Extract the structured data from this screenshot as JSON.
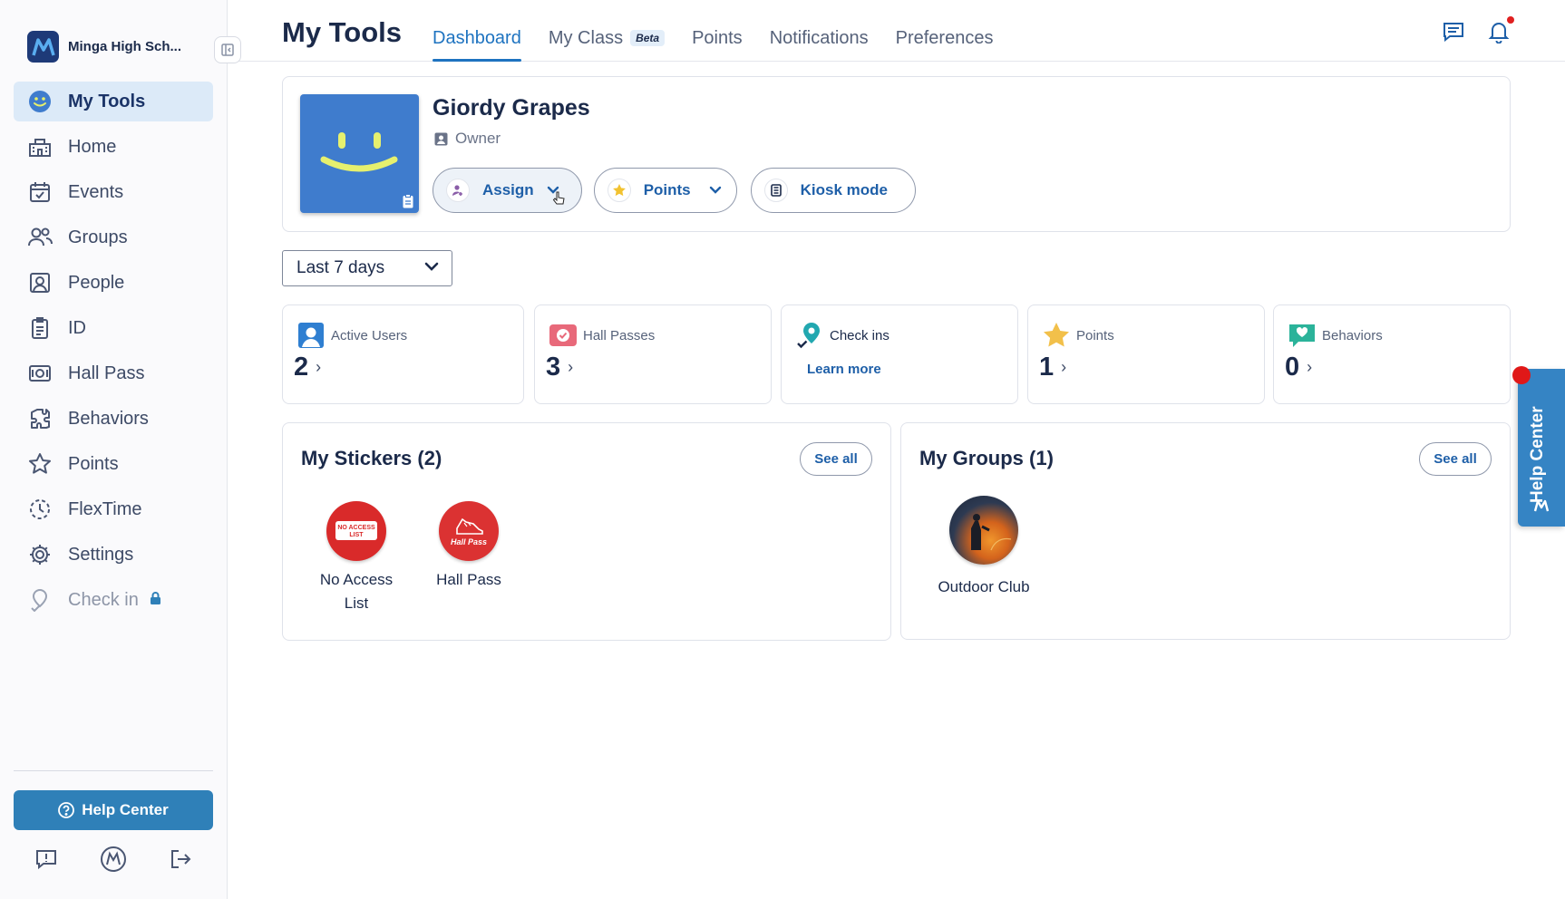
{
  "school": {
    "name": "Minga High Sch..."
  },
  "sidebar": {
    "items": [
      {
        "label": "My Tools",
        "icon": "smiley-icon"
      },
      {
        "label": "Home",
        "icon": "school-building-icon"
      },
      {
        "label": "Events",
        "icon": "calendar-icon"
      },
      {
        "label": "Groups",
        "icon": "people-group-icon"
      },
      {
        "label": "People",
        "icon": "person-badge-icon"
      },
      {
        "label": "ID",
        "icon": "id-badge-icon"
      },
      {
        "label": "Hall Pass",
        "icon": "ticket-icon"
      },
      {
        "label": "Behaviors",
        "icon": "puzzle-icon"
      },
      {
        "label": "Points",
        "icon": "star-icon"
      },
      {
        "label": "FlexTime",
        "icon": "clock-dashed-icon"
      },
      {
        "label": "Settings",
        "icon": "gear-icon"
      },
      {
        "label": "Check in",
        "icon": "location-check-icon",
        "locked": true
      }
    ],
    "help_label": "Help Center"
  },
  "header": {
    "title": "My Tools",
    "tabs": [
      {
        "label": "Dashboard",
        "active": true
      },
      {
        "label": "My Class",
        "badge": "Beta"
      },
      {
        "label": "Points"
      },
      {
        "label": "Notifications"
      },
      {
        "label": "Preferences"
      }
    ]
  },
  "profile": {
    "name": "Giordy Grapes",
    "role": "Owner",
    "actions": {
      "assign": "Assign",
      "points": "Points",
      "kiosk": "Kiosk mode"
    }
  },
  "date_range": {
    "selected": "Last 7 days"
  },
  "stats": {
    "active_users": {
      "label": "Active Users",
      "value": "2",
      "arrow": "›"
    },
    "hall_passes": {
      "label": "Hall Passes",
      "value": "3",
      "arrow": "›"
    },
    "check_ins": {
      "label": "Check ins",
      "link": "Learn more"
    },
    "points": {
      "label": "Points",
      "value": "1",
      "arrow": "›"
    },
    "behaviors": {
      "label": "Behaviors",
      "value": "0",
      "arrow": "›"
    }
  },
  "stickers": {
    "title": "My Stickers (2)",
    "see_all": "See all",
    "items": [
      {
        "label": "No Access List",
        "art_text": "NO ACCESS LIST"
      },
      {
        "label": "Hall Pass",
        "art_text": "Hall Pass"
      }
    ]
  },
  "groups": {
    "title": "My Groups (1)",
    "see_all": "See all",
    "items": [
      {
        "label": "Outdoor Club"
      }
    ]
  },
  "help_tab": {
    "label": "Help Center"
  },
  "colors": {
    "accent": "#1e73c0",
    "brand": "#1e3a78",
    "help": "#3584c4",
    "active_nav_bg": "#dceaf8"
  }
}
